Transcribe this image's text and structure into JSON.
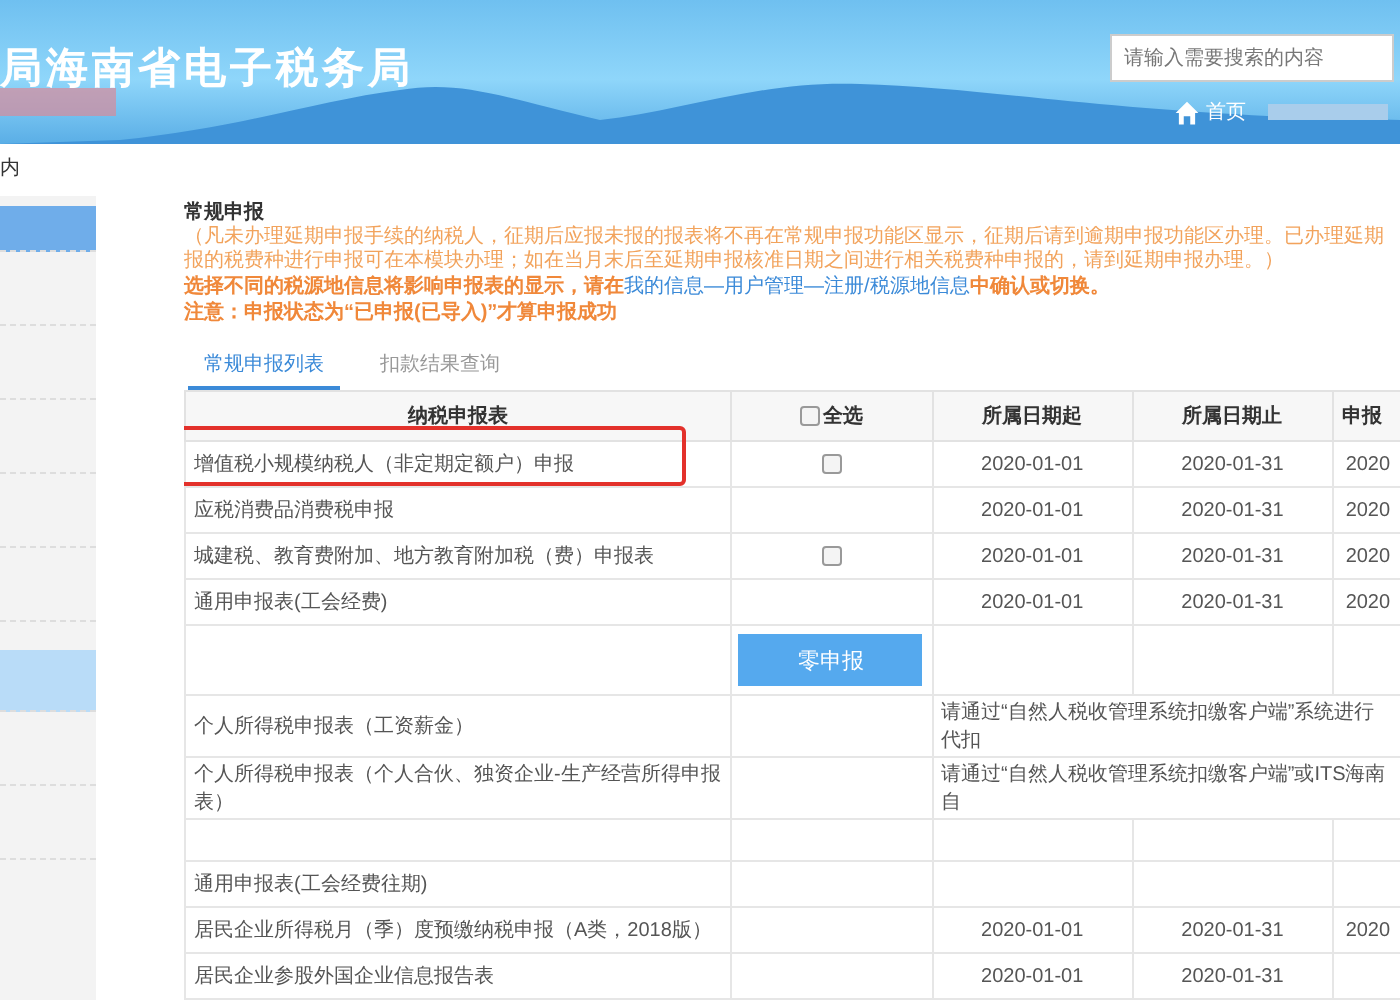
{
  "header": {
    "title": "局海南省电子税务局",
    "search": {
      "placeholder": "请输入需要搜索的内容"
    },
    "home_link": "首页"
  },
  "breadcrumb": "内",
  "sidebar": {
    "items": [
      {
        "selected": true,
        "hovered": false
      },
      {
        "selected": false,
        "hovered": false
      },
      {
        "selected": false,
        "hovered": false
      },
      {
        "selected": false,
        "hovered": false
      },
      {
        "selected": false,
        "hovered": false
      },
      {
        "selected": false,
        "hovered": false
      },
      {
        "selected": false,
        "hovered": true
      },
      {
        "selected": false,
        "hovered": false
      },
      {
        "selected": false,
        "hovered": false
      }
    ]
  },
  "section_title": "常规申报",
  "notice_lines": [
    "（凡未办理延期申报手续的纳税人，征期后应报未报的报表将不再在常规申报功能区显示，征期后请到逾期申报功能区办理。已办理延期",
    "报的税费种进行申报可在本模块办理；如在当月末后至延期申报核准日期之间进行相关税费种申报的，请到延期申报办理。）"
  ],
  "source_notice": {
    "before": "选择不同的税源地信息将影响申报表的显示，请在",
    "link": "我的信息—用户管理—注册/税源地信息",
    "after": "中确认或切换。"
  },
  "warning": "注意：申报状态为“已申报(已导入)”才算申报成功",
  "tabs": [
    {
      "label": "常规申报列表",
      "selected": true
    },
    {
      "label": "扣款结果查询",
      "selected": false
    }
  ],
  "table": {
    "columns": [
      "纳税申报表",
      "全选",
      "所属日期起",
      "所属日期止",
      "申报"
    ],
    "select_all_checked": false,
    "rows": [
      {
        "kind": "dated",
        "name": "增值税小规模纳税人（非定期定额户）申报",
        "checked": false,
        "highlighted": true,
        "start": "2020-01-01",
        "end": "2020-01-31",
        "column_5": "2020"
      },
      {
        "kind": "dated",
        "name": "应税消费品消费税申报",
        "highlighted": false,
        "start": "2020-01-01",
        "end": "2020-01-31",
        "column_5": "2020"
      },
      {
        "kind": "dated",
        "name": "城建税、教育费附加、地方教育附加税（费）申报表",
        "checked": false,
        "highlighted": false,
        "start": "2020-01-01",
        "end": "2020-01-31",
        "column_5": "2020"
      },
      {
        "kind": "dated",
        "name": "通用申报表(工会经费)",
        "highlighted": false,
        "start": "2020-01-01",
        "end": "2020-01-31",
        "column_5": "2020"
      },
      {
        "kind": "action",
        "button": "零申报"
      },
      {
        "kind": "message",
        "name": "个人所得税申报表（工资薪金）",
        "message": "请通过“自然人税收管理系统扣缴客户端”系统进行代扣"
      },
      {
        "kind": "message",
        "name": "个人所得税申报表（个人合伙、独资企业-生产经营所得申报表）",
        "message": "请通过“自然人税收管理系统扣缴客户端”或ITS海南自"
      },
      {
        "kind": "blank"
      },
      {
        "kind": "dated",
        "name": "通用申报表(工会经费往期)",
        "highlighted": false
      },
      {
        "kind": "dated",
        "name": "居民企业所得税月（季）度预缴纳税申报（A类，2018版）",
        "highlighted": false,
        "start": "2020-01-01",
        "end": "2020-01-31",
        "column_5": "2020"
      },
      {
        "kind": "dated",
        "name": "居民企业参股外国企业信息报告表",
        "highlighted": false,
        "start": "2020-01-01",
        "end": "2020-01-31"
      }
    ]
  }
}
